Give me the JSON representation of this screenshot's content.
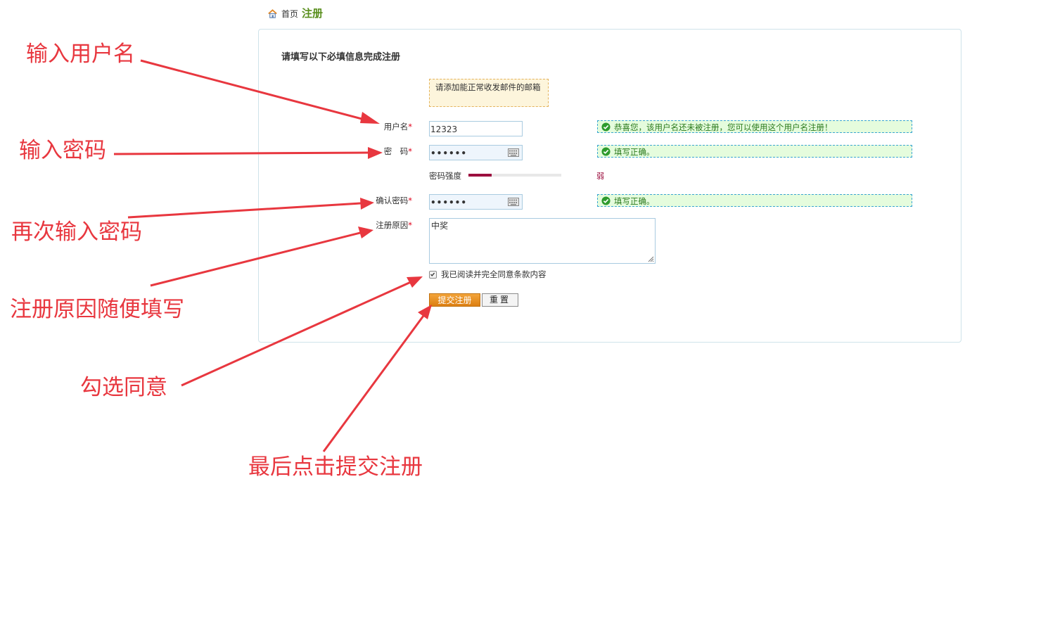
{
  "breadcrumb": {
    "home": "首页",
    "current": "注册"
  },
  "form": {
    "title": "请填写以下必填信息完成注册",
    "email_tip": "请添加能正常收发邮件的邮箱",
    "required_mark": "*",
    "username": {
      "label": "用户名",
      "value": "12323",
      "message": "恭喜您，该用户名还未被注册，您可以使用这个用户名注册！"
    },
    "password": {
      "label": "密　码",
      "value": "••••••",
      "message": "填写正确。"
    },
    "strength": {
      "label": "密码强度",
      "level_word": "弱",
      "level_fraction": 0.25
    },
    "confirm": {
      "label": "确认密码",
      "value": "••••••",
      "message": "填写正确。"
    },
    "reason": {
      "label": "注册原因",
      "value": "中奖"
    },
    "agree": {
      "label": "我已阅读并完全同意条款内容",
      "checked": true
    },
    "submit_label": "提交注册",
    "reset_label": "重置"
  },
  "annotations": {
    "username": "输入用户名",
    "password": "输入密码",
    "confirm": "再次输入密码",
    "reason": "注册原因随便填写",
    "agree": "勾选同意",
    "submit": "最后点击提交注册"
  },
  "colors": {
    "annotation": "#e8373f",
    "accent_green": "#5a8f1e",
    "submit_orange": "#dc7f12",
    "success_bg": "#e5fcdd"
  },
  "icons": [
    "home-icon",
    "keyboard-icon",
    "check-circle-icon",
    "resize-grip-icon",
    "checkbox-checked-icon"
  ]
}
